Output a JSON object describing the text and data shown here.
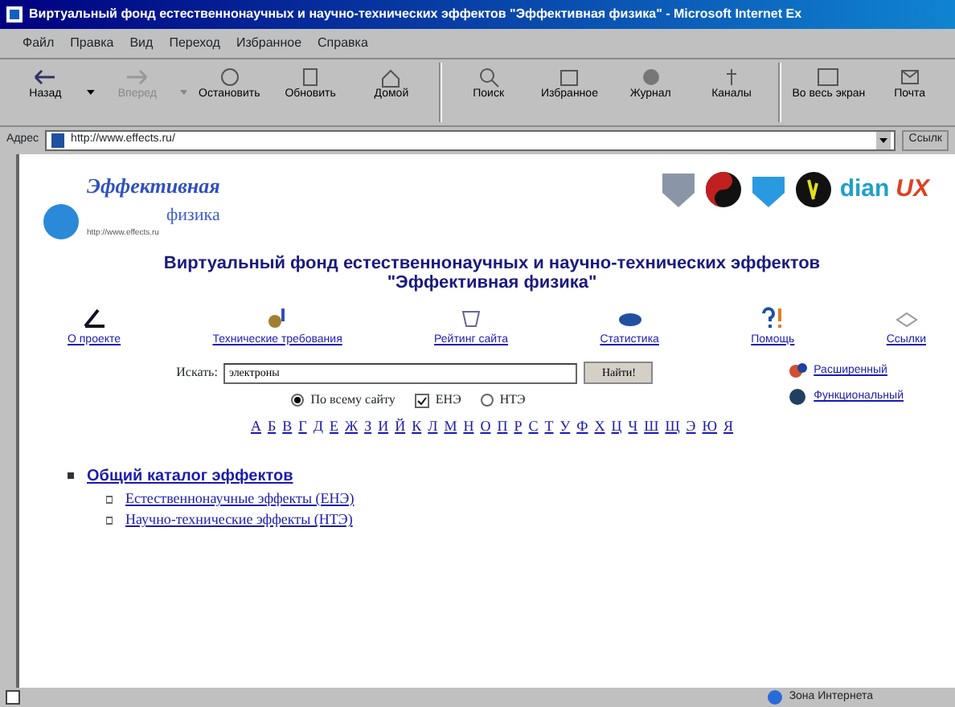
{
  "window": {
    "title": "Виртуальный фонд естественнонаучных и научно-технических эффектов \"Эффективная физика\" - Microsoft Internet Ex"
  },
  "menu": [
    "Файл",
    "Правка",
    "Вид",
    "Переход",
    "Избранное",
    "Справка"
  ],
  "toolbar": [
    {
      "label": "Назад",
      "disabled": false,
      "dropdown": true
    },
    {
      "label": "Вперед",
      "disabled": true,
      "dropdown": true
    },
    {
      "label": "Остановить",
      "disabled": false,
      "dropdown": false
    },
    {
      "label": "Обновить",
      "disabled": false,
      "dropdown": false
    },
    {
      "label": "Домой",
      "disabled": false,
      "dropdown": false
    },
    {
      "label": "Поиск",
      "disabled": false,
      "dropdown": false,
      "group_start": true
    },
    {
      "label": "Избранное",
      "disabled": false,
      "dropdown": false
    },
    {
      "label": "Журнал",
      "disabled": false,
      "dropdown": false
    },
    {
      "label": "Каналы",
      "disabled": false,
      "dropdown": false
    },
    {
      "label": "Во весь экран",
      "disabled": false,
      "dropdown": false,
      "group_start": true
    },
    {
      "label": "Почта",
      "disabled": false,
      "dropdown": false
    }
  ],
  "address_bar": {
    "label": "Адрес",
    "value": "http://www.effects.ru/",
    "links_label": "Ссылк"
  },
  "page": {
    "logo": {
      "line1": "Эффективная",
      "line2": "физика",
      "url": "http://www.effects.ru"
    },
    "partner_logos": {
      "text1": "dian",
      "text2": "UX"
    },
    "heading": "Виртуальный фонд естественнонаучных и научно-технических эффектов \"Эффективная физика\"",
    "nav": [
      "О проекте",
      "Технические требования",
      "Рейтинг сайта",
      "Статистика",
      "Помощь",
      "Ссылки"
    ],
    "search": {
      "label": "Искать:",
      "value": "электроны",
      "button": "Найти!",
      "scope": [
        {
          "kind": "radio",
          "label": "По всему сайту",
          "selected": true
        },
        {
          "kind": "checkbox",
          "label": "ЕНЭ",
          "checked": true
        },
        {
          "kind": "radio",
          "label": "НТЭ",
          "selected": false
        }
      ],
      "modes": [
        "Расширенный",
        "Функциональный"
      ]
    },
    "alphabet": [
      "А",
      "Б",
      "В",
      "Г",
      "Д",
      "Е",
      "Ж",
      "З",
      "И",
      "Й",
      "К",
      "Л",
      "М",
      "Н",
      "О",
      "П",
      "Р",
      "С",
      "Т",
      "У",
      "Ф",
      "Х",
      "Ц",
      "Ч",
      "Ш",
      "Щ",
      "Э",
      "Ю",
      "Я"
    ],
    "catalog": [
      {
        "label": "Общий каталог эффектов",
        "children": [
          {
            "label": "Естественнонаучные эффекты (ЕНЭ)"
          },
          {
            "label": "Научно-технические эффекты (НТЭ)"
          }
        ]
      }
    ]
  },
  "status_bar": {
    "zone": "Зона Интернета"
  }
}
